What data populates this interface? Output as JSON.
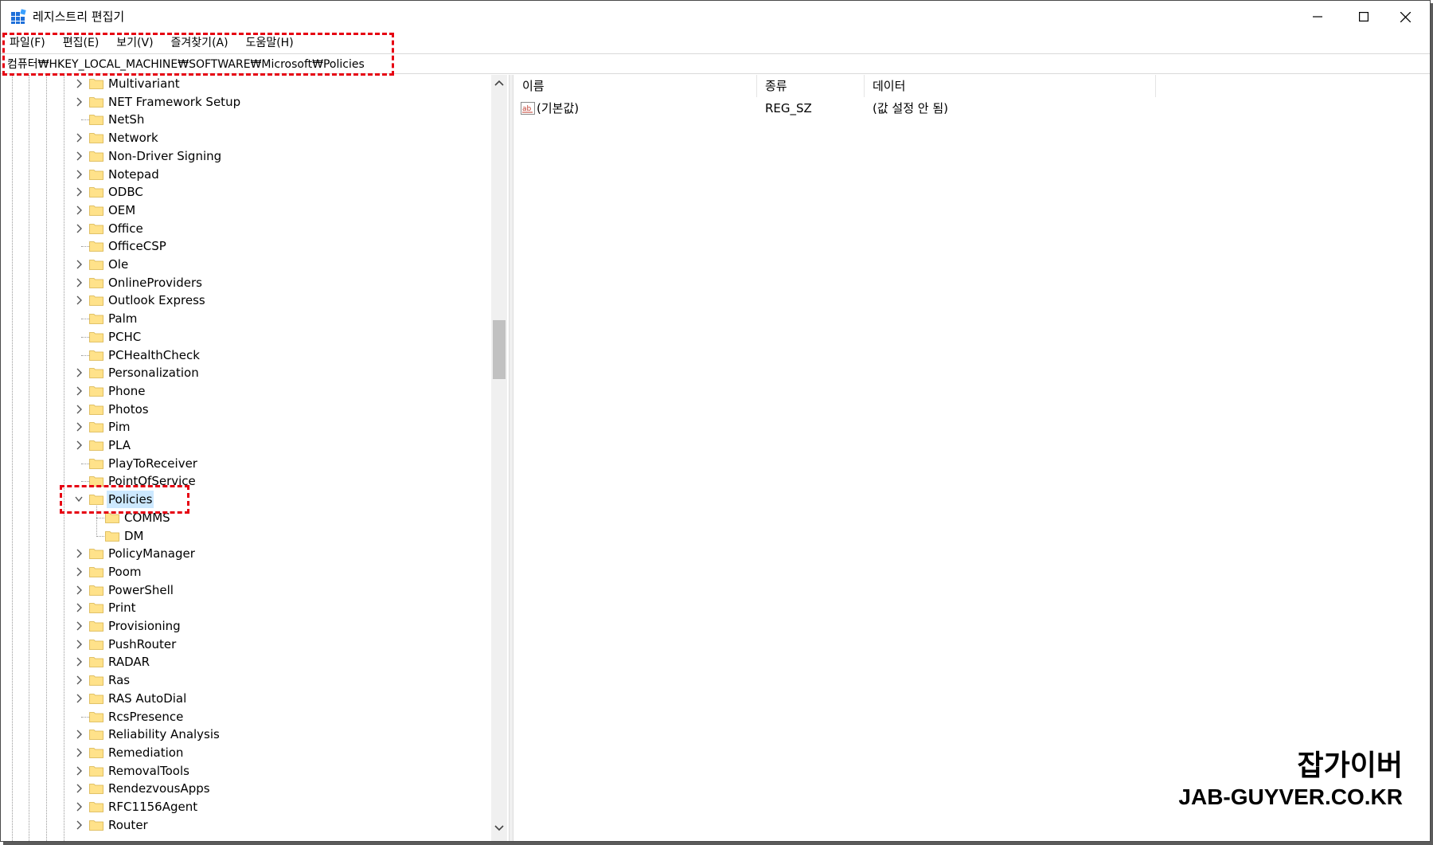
{
  "window": {
    "title": "레지스트리 편집기",
    "controls": [
      "minimize",
      "maximize",
      "close"
    ]
  },
  "menu": [
    "파일(F)",
    "편집(E)",
    "보기(V)",
    "즐겨찾기(A)",
    "도움말(H)"
  ],
  "address": "컴퓨터₩HKEY_LOCAL_MACHINE₩SOFTWARE₩Microsoft₩Policies",
  "tree": {
    "items": [
      {
        "label": "Multivariant",
        "expandable": true
      },
      {
        "label": "NET Framework Setup",
        "expandable": true
      },
      {
        "label": "NetSh",
        "expandable": false
      },
      {
        "label": "Network",
        "expandable": true
      },
      {
        "label": "Non-Driver Signing",
        "expandable": true
      },
      {
        "label": "Notepad",
        "expandable": true
      },
      {
        "label": "ODBC",
        "expandable": true
      },
      {
        "label": "OEM",
        "expandable": true
      },
      {
        "label": "Office",
        "expandable": true
      },
      {
        "label": "OfficeCSP",
        "expandable": false
      },
      {
        "label": "Ole",
        "expandable": true
      },
      {
        "label": "OnlineProviders",
        "expandable": true
      },
      {
        "label": "Outlook Express",
        "expandable": true
      },
      {
        "label": "Palm",
        "expandable": false
      },
      {
        "label": "PCHC",
        "expandable": false
      },
      {
        "label": "PCHealthCheck",
        "expandable": false
      },
      {
        "label": "Personalization",
        "expandable": true
      },
      {
        "label": "Phone",
        "expandable": true
      },
      {
        "label": "Photos",
        "expandable": true
      },
      {
        "label": "Pim",
        "expandable": true
      },
      {
        "label": "PLA",
        "expandable": true
      },
      {
        "label": "PlayToReceiver",
        "expandable": false
      },
      {
        "label": "PointOfService",
        "expandable": false
      },
      {
        "label": "Policies",
        "expandable": true,
        "expanded": true,
        "selected": true
      },
      {
        "label": "COMMS",
        "expandable": false,
        "child": true
      },
      {
        "label": "DM",
        "expandable": false,
        "child": true
      },
      {
        "label": "PolicyManager",
        "expandable": true
      },
      {
        "label": "Poom",
        "expandable": true
      },
      {
        "label": "PowerShell",
        "expandable": true
      },
      {
        "label": "Print",
        "expandable": true
      },
      {
        "label": "Provisioning",
        "expandable": true
      },
      {
        "label": "PushRouter",
        "expandable": true
      },
      {
        "label": "RADAR",
        "expandable": true
      },
      {
        "label": "Ras",
        "expandable": true
      },
      {
        "label": "RAS AutoDial",
        "expandable": true
      },
      {
        "label": "RcsPresence",
        "expandable": false
      },
      {
        "label": "Reliability Analysis",
        "expandable": true
      },
      {
        "label": "Remediation",
        "expandable": true
      },
      {
        "label": "RemovalTools",
        "expandable": true
      },
      {
        "label": "RendezvousApps",
        "expandable": true
      },
      {
        "label": "RFC1156Agent",
        "expandable": true
      },
      {
        "label": "Router",
        "expandable": true
      }
    ]
  },
  "list": {
    "columns": [
      "이름",
      "종류",
      "데이터"
    ],
    "rows": [
      {
        "name": "(기본값)",
        "type": "REG_SZ",
        "data": "(값 설정 안 됨)",
        "icon": "string-value-icon"
      }
    ]
  },
  "watermark": {
    "title": "잡가이버",
    "site": "JAB-GUYVER.CO.KR"
  },
  "colors": {
    "selection": "#cce8ff",
    "highlight_box": "#e60012",
    "folder": "#ffe28a"
  }
}
